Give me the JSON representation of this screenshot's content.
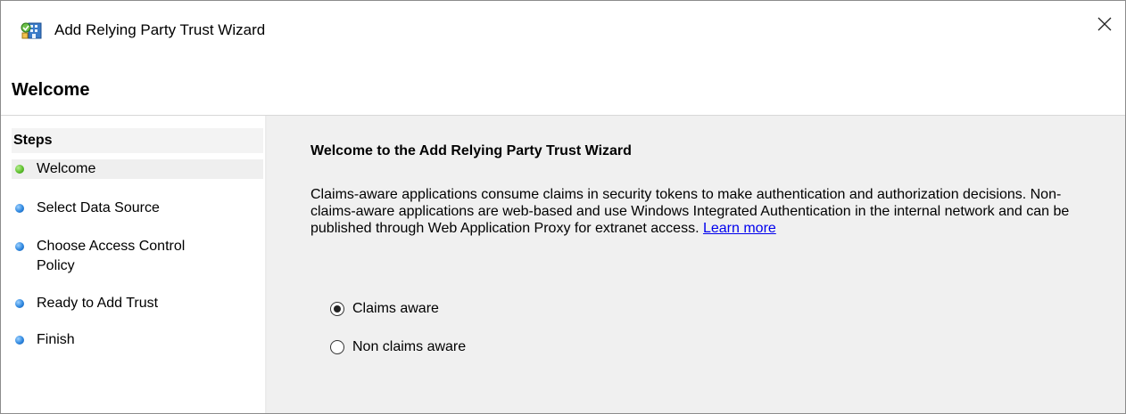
{
  "window": {
    "title": "Add Relying Party Trust Wizard",
    "close_icon": "close-icon",
    "app_icon": "relying-party-trust-icon"
  },
  "header": {
    "page_title": "Welcome"
  },
  "steps": {
    "heading": "Steps",
    "items": [
      {
        "label": "Welcome",
        "status": "current",
        "color": "#4caf27"
      },
      {
        "label": "Select Data Source",
        "status": "pending",
        "color": "#2a7fd8"
      },
      {
        "label": "Choose Access Control Policy",
        "status": "pending",
        "color": "#2a7fd8"
      },
      {
        "label": "Ready to Add Trust",
        "status": "pending",
        "color": "#2a7fd8"
      },
      {
        "label": "Finish",
        "status": "pending",
        "color": "#2a7fd8"
      }
    ]
  },
  "main": {
    "title": "Welcome to the Add Relying Party Trust Wizard",
    "description": "Claims-aware applications consume claims in security tokens to make authentication and authorization decisions. Non-claims-aware applications are web-based and use Windows Integrated Authentication in the internal network and can be published through Web Application Proxy for extranet access.",
    "learn_more": "Learn more",
    "options": [
      {
        "label": "Claims aware",
        "checked": true
      },
      {
        "label": "Non claims aware",
        "checked": false
      }
    ]
  },
  "colors": {
    "link": "#0000ee",
    "main_background": "#f0f0f0"
  }
}
